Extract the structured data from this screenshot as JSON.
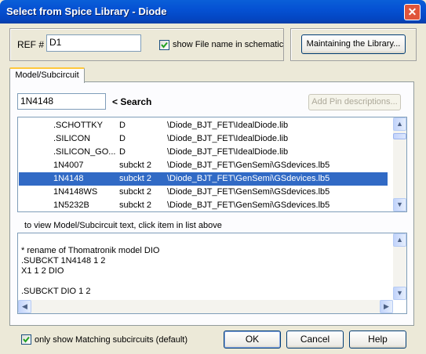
{
  "window": {
    "title": "Select from Spice Library - Diode",
    "close_glyph": "✕"
  },
  "header": {
    "ref_label": "REF #",
    "ref_value": "D1",
    "show_file_name_label": "show File name in schematic",
    "show_file_name_checked": true,
    "maintain_button": "Maintaining the Library..."
  },
  "tabs": [
    {
      "label": "Model/Subcircuit",
      "active": true
    }
  ],
  "search": {
    "value": "1N4148",
    "label": "< Search",
    "add_pin_button": "Add Pin descriptions..."
  },
  "list": {
    "rows": [
      {
        "name": ".SCHOTTKY",
        "type": "D",
        "path": "\\Diode_BJT_FET\\IdealDiode.lib",
        "selected": false
      },
      {
        "name": ".SILICON",
        "type": "D",
        "path": "\\Diode_BJT_FET\\IdealDiode.lib",
        "selected": false
      },
      {
        "name": ".SILICON_GO...",
        "type": "D",
        "path": "\\Diode_BJT_FET\\IdealDiode.lib",
        "selected": false
      },
      {
        "name": "1N4007",
        "type": "subckt 2",
        "path": "\\Diode_BJT_FET\\GenSemi\\GSdevices.lb5",
        "selected": false
      },
      {
        "name": "1N4148",
        "type": "subckt 2",
        "path": "\\Diode_BJT_FET\\GenSemi\\GSdevices.lb5",
        "selected": true
      },
      {
        "name": "1N4148WS",
        "type": "subckt 2",
        "path": "\\Diode_BJT_FET\\GenSemi\\GSdevices.lb5",
        "selected": false
      },
      {
        "name": "1N5232B",
        "type": "subckt 2",
        "path": "\\Diode_BJT_FET\\GenSemi\\GSdevices.lb5",
        "selected": false
      }
    ]
  },
  "hint": "to view Model/Subcircuit text, click item in list above",
  "model_text": [
    "* rename of Thomatronik model DIO",
    ".SUBCKT 1N4148  1  2",
    "X1 1 2 DIO",
    "",
    ".SUBCKT DIO 1 2"
  ],
  "footer": {
    "only_matching_label": "only show Matching subcircuits (default)",
    "only_matching_checked": true,
    "ok": "OK",
    "cancel": "Cancel",
    "help": "Help"
  }
}
